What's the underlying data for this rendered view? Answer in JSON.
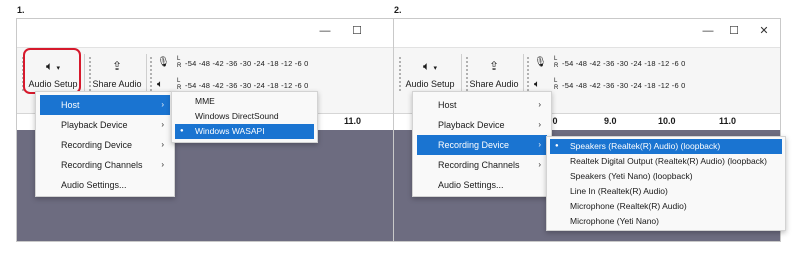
{
  "step1": {
    "number": "1.",
    "window_controls": {
      "minimize": "—",
      "maximize": "☐"
    },
    "toolbar": {
      "audio_setup_label": "Audio Setup",
      "share_audio_label": "Share Audio",
      "meter_lr": "L\nR",
      "meter_scale": "-54 -48 -42 -36 -30 -24 -18 -12  -6  0"
    },
    "ruler_ticks": [
      "11.0"
    ],
    "menu": {
      "items": [
        {
          "label": "Host",
          "has_submenu": true,
          "highlighted": true
        },
        {
          "label": "Playback Device",
          "has_submenu": true,
          "highlighted": false
        },
        {
          "label": "Recording Device",
          "has_submenu": true,
          "highlighted": false
        },
        {
          "label": "Recording Channels",
          "has_submenu": true,
          "highlighted": false
        },
        {
          "label": "Audio Settings...",
          "has_submenu": false,
          "highlighted": false
        }
      ]
    },
    "submenu": {
      "items": [
        {
          "label": "MME",
          "selected": false
        },
        {
          "label": "Windows DirectSound",
          "selected": false
        },
        {
          "label": "Windows WASAPI",
          "selected": true
        }
      ]
    }
  },
  "step2": {
    "number": "2.",
    "window_controls": {
      "minimize": "—",
      "maximize": "☐",
      "close": "✕"
    },
    "toolbar": {
      "audio_setup_label": "Audio Setup",
      "share_audio_label": "Share Audio",
      "meter_lr": "L\nR",
      "meter_scale": "-54 -48 -42 -36 -30 -24 -18 -12  -6  0"
    },
    "ruler_ticks": [
      ".0",
      "9.0",
      "10.0",
      "11.0"
    ],
    "menu": {
      "items": [
        {
          "label": "Host",
          "has_submenu": true,
          "highlighted": false
        },
        {
          "label": "Playback Device",
          "has_submenu": true,
          "highlighted": false
        },
        {
          "label": "Recording Device",
          "has_submenu": true,
          "highlighted": true
        },
        {
          "label": "Recording Channels",
          "has_submenu": true,
          "highlighted": false
        },
        {
          "label": "Audio Settings...",
          "has_submenu": false,
          "highlighted": false
        }
      ]
    },
    "submenu": {
      "items": [
        {
          "label": "Speakers (Realtek(R) Audio) (loopback)",
          "selected": true
        },
        {
          "label": "Realtek Digital Output (Realtek(R) Audio) (loopback)",
          "selected": false
        },
        {
          "label": "Speakers (Yeti Nano) (loopback)",
          "selected": false
        },
        {
          "label": "Line In (Realtek(R) Audio)",
          "selected": false
        },
        {
          "label": "Microphone (Realtek(R) Audio)",
          "selected": false
        },
        {
          "label": "Microphone (Yeti Nano)",
          "selected": false
        }
      ]
    }
  },
  "icons": {
    "speaker": "speaker-icon",
    "share": "share-icon",
    "microphone": "microphone-icon",
    "chevron_down": "chevron-down-icon",
    "chevron_right": "chevron-right-icon",
    "radio_dot": "radio-dot-icon"
  },
  "colors": {
    "highlight": "#1a74d1",
    "annotation": "#d6192c",
    "track_bg": "#6d6c80"
  }
}
